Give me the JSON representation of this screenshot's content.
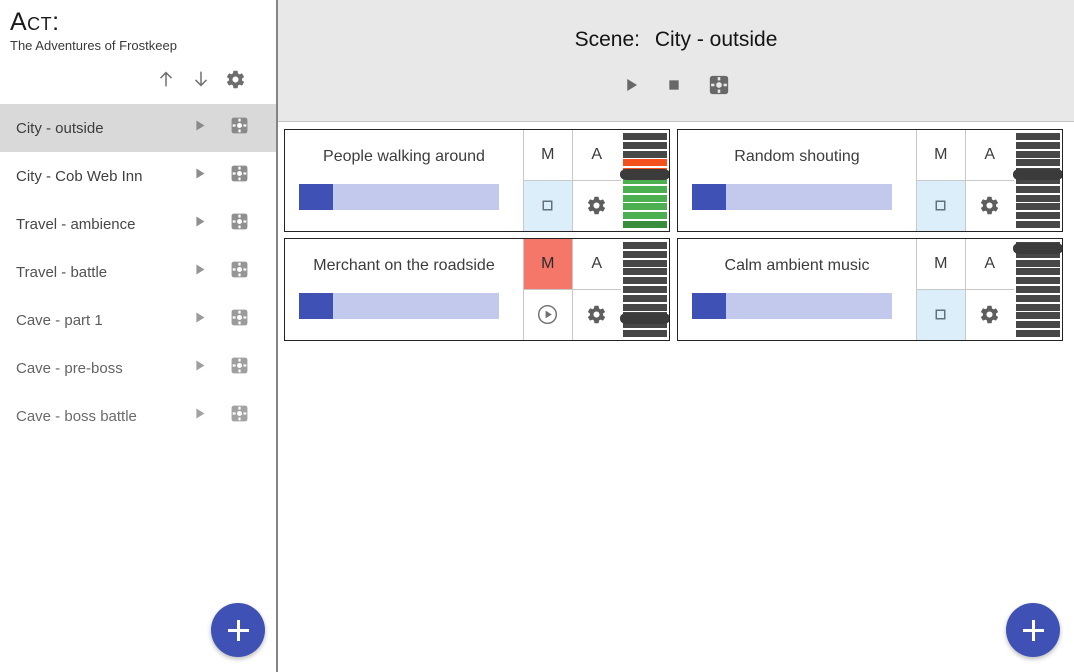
{
  "sidebar": {
    "act_label": "Act:",
    "act_subtitle": "The Adventures of Frostkeep",
    "toolbar": [
      {
        "name": "move-up-icon",
        "glyph": "arrow-up"
      },
      {
        "name": "move-down-icon",
        "glyph": "arrow-down"
      },
      {
        "name": "settings-icon",
        "glyph": "gear"
      }
    ],
    "scenes": [
      {
        "label": "City - outside",
        "selected": true,
        "text_color": "#3c3c3c",
        "icon_color": "#8a8a8a"
      },
      {
        "label": "City - Cob Web Inn",
        "selected": false,
        "text_color": "#3f3f3f",
        "icon_color": "#8d8d8d"
      },
      {
        "label": "Travel - ambience",
        "selected": false,
        "text_color": "#474747",
        "icon_color": "#909090"
      },
      {
        "label": "Travel - battle",
        "selected": false,
        "text_color": "#525252",
        "icon_color": "#969696"
      },
      {
        "label": "Cave - part 1",
        "selected": false,
        "text_color": "#5c5c5c",
        "icon_color": "#9b9b9b"
      },
      {
        "label": "Cave - pre-boss",
        "selected": false,
        "text_color": "#646464",
        "icon_color": "#9f9f9f"
      },
      {
        "label": "Cave - boss battle",
        "selected": false,
        "text_color": "#6b6b6b",
        "icon_color": "#a3a3a3"
      }
    ],
    "add_button_label": "+"
  },
  "header": {
    "scene_label": "Scene:",
    "scene_name": "City - outside",
    "transport": [
      {
        "name": "play-button",
        "glyph": "play"
      },
      {
        "name": "stop-button",
        "glyph": "stop"
      },
      {
        "name": "settings-button",
        "glyph": "gear-square"
      }
    ]
  },
  "main": {
    "add_button_label": "+",
    "cards": [
      {
        "title": "People walking around",
        "progress": 17,
        "mute_label": "M",
        "mute_active": false,
        "auto_label": "A",
        "auto_active": false,
        "transport_glyph": "stop-square",
        "transport_active": true,
        "settings_glyph": "gear",
        "meter": {
          "thumb_index": 4,
          "segments": [
            "#474747",
            "#474747",
            "#474747",
            "#f4501e",
            "#f4501e",
            "#4caf50",
            "#4caf50",
            "#4caf50",
            "#4caf50",
            "#4caf50",
            "#388e3c"
          ]
        }
      },
      {
        "title": "Random shouting",
        "progress": 17,
        "mute_label": "M",
        "mute_active": false,
        "auto_label": "A",
        "auto_active": false,
        "transport_glyph": "stop-square",
        "transport_active": true,
        "settings_glyph": "gear",
        "meter": {
          "thumb_index": 4,
          "segments": [
            "#474747",
            "#474747",
            "#474747",
            "#474747",
            "#474747",
            "#474747",
            "#474747",
            "#474747",
            "#474747",
            "#474747",
            "#474747"
          ]
        }
      },
      {
        "title": "Merchant on the roadside",
        "progress": 17,
        "mute_label": "M",
        "mute_active": true,
        "auto_label": "A",
        "auto_active": false,
        "transport_glyph": "play-circle",
        "transport_active": false,
        "settings_glyph": "gear",
        "meter": {
          "thumb_index": 8,
          "segments": [
            "#474747",
            "#474747",
            "#474747",
            "#474747",
            "#474747",
            "#474747",
            "#474747",
            "#474747",
            "#474747",
            "#474747",
            "#474747"
          ]
        }
      },
      {
        "title": "Calm ambient music",
        "progress": 17,
        "mute_label": "M",
        "mute_active": false,
        "auto_label": "A",
        "auto_active": false,
        "transport_glyph": "stop-square",
        "transport_active": true,
        "settings_glyph": "gear",
        "meter": {
          "thumb_index": 0,
          "segments": [
            "#474747",
            "#474747",
            "#474747",
            "#474747",
            "#474747",
            "#474747",
            "#474747",
            "#474747",
            "#474747",
            "#474747",
            "#474747"
          ]
        }
      }
    ]
  },
  "colors": {
    "accent": "#3f51b5",
    "progress_track": "#c3c9ec",
    "mute_active": "#f4776a",
    "transport_active_bg": "#ddeefb",
    "header_bg": "#e8e8e8",
    "selected_row": "#d9d9d9"
  }
}
